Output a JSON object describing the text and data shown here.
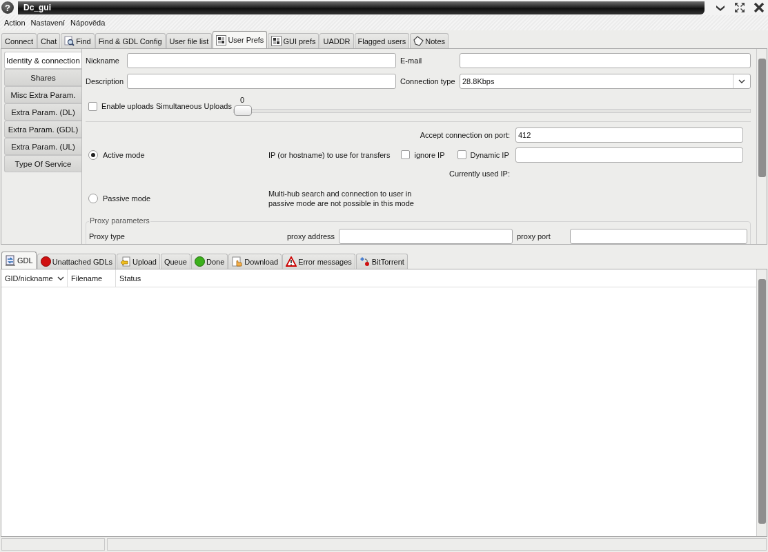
{
  "window": {
    "title": "Dc_gui",
    "help_glyph": "?"
  },
  "menu": [
    "Action",
    "Nastavení",
    "Nápověda"
  ],
  "tabs": [
    {
      "label": "Connect",
      "kind": "plain",
      "selected": false
    },
    {
      "label": "Chat",
      "kind": "plain",
      "selected": false
    },
    {
      "label": "Find",
      "kind": "search",
      "selected": false
    },
    {
      "label": "Find & GDL Config",
      "kind": "plain",
      "selected": false
    },
    {
      "label": "User file list",
      "kind": "plain",
      "selected": false
    },
    {
      "label": "User Prefs",
      "kind": "grid",
      "selected": true
    },
    {
      "label": "GUI prefs",
      "kind": "grid",
      "selected": false
    },
    {
      "label": "UADDR",
      "kind": "plain",
      "selected": false
    },
    {
      "label": "Flagged users",
      "kind": "plain",
      "selected": false
    },
    {
      "label": "Notes",
      "kind": "tag",
      "selected": false
    }
  ],
  "side_tabs": [
    {
      "label": "Identity & connection",
      "selected": true
    },
    {
      "label": "Shares",
      "selected": false
    },
    {
      "label": "Misc Extra Param.",
      "selected": false
    },
    {
      "label": "Extra Param. (DL)",
      "selected": false
    },
    {
      "label": "Extra Param. (GDL)",
      "selected": false
    },
    {
      "label": "Extra Param. (UL)",
      "selected": false
    },
    {
      "label": "Type Of Service",
      "selected": false
    }
  ],
  "identity": {
    "nickname_label": "Nickname",
    "email_label": "E-mail",
    "description_label": "Description",
    "connection_type_label": "Connection type",
    "connection_type": "28.8Kbps"
  },
  "uploads": {
    "label": "Enable uploads Simultaneous Uploads",
    "checked": false,
    "value": "0",
    "level": 0
  },
  "port": {
    "label": "Accept connection on port:",
    "value": "412"
  },
  "modes": [
    {
      "label": "Active mode",
      "selected": true
    },
    {
      "label": "Passive mode",
      "selected": false
    }
  ],
  "ip": {
    "label": "IP (or hostname) to use for transfers",
    "ignore_label": "ignore IP",
    "ignore_checked": false,
    "dynamic_label": "Dynamic IP",
    "dynamic_checked": false,
    "current_label": "Currently used IP:"
  },
  "passive_note": "Multi-hub search and connection to user in passive mode are not possible in this mode",
  "proxy": {
    "title": "Proxy parameters",
    "type_label": "Proxy type",
    "address_label": "proxy address",
    "port_label": "proxy port"
  },
  "bottom_tabs": [
    {
      "label": "GDL",
      "kind": "transfer",
      "selected": true
    },
    {
      "label": "Unattached GDLs",
      "kind": "red-dot",
      "selected": false
    },
    {
      "label": "Upload",
      "kind": "upload",
      "selected": false
    },
    {
      "label": "Queue",
      "kind": "plain",
      "selected": false
    },
    {
      "label": "Done",
      "kind": "green-dot",
      "selected": false
    },
    {
      "label": "Download",
      "kind": "download",
      "selected": false
    },
    {
      "label": "Error messages",
      "kind": "warning",
      "selected": false
    },
    {
      "label": "BitTorrent",
      "kind": "torrent",
      "selected": false
    }
  ],
  "table": {
    "columns": [
      {
        "label": "GID/nickname",
        "sorted": true
      },
      {
        "label": "Filename",
        "sorted": false
      },
      {
        "label": "Status",
        "sorted": false
      }
    ]
  }
}
